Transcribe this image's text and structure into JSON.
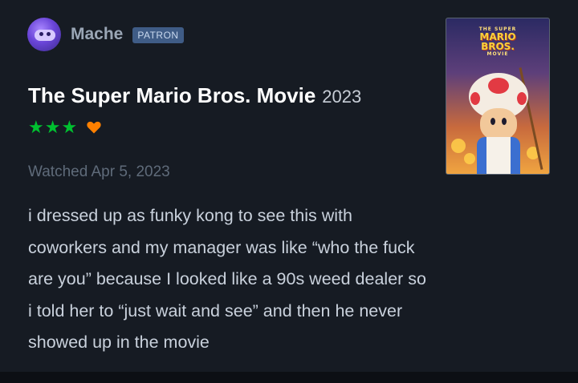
{
  "user": {
    "name": "Mache",
    "badge": "PATRON"
  },
  "film": {
    "title": "The Super Mario Bros. Movie",
    "year": "2023",
    "poster_title_small": "THE SUPER",
    "poster_title_line1": "MARIO",
    "poster_title_line2": "BROS.",
    "poster_title_line3": "MOVIE"
  },
  "rating": {
    "stars": 3,
    "liked": true,
    "star_glyph": "★",
    "star_color": "#00c030",
    "heart_color": "#ff8000"
  },
  "watched": "Watched Apr 5, 2023",
  "review": {
    "lines": [
      "i dressed up as funky kong to see this with",
      "coworkers and my manager was like “who the fuck",
      "are you” because I looked like a 90s weed dealer so",
      "i told her to “just wait and see” and then he never",
      "showed up in the movie"
    ]
  },
  "icons": {
    "avatar": "avatar-icon",
    "heart": "heart-icon",
    "star": "star-icon"
  }
}
